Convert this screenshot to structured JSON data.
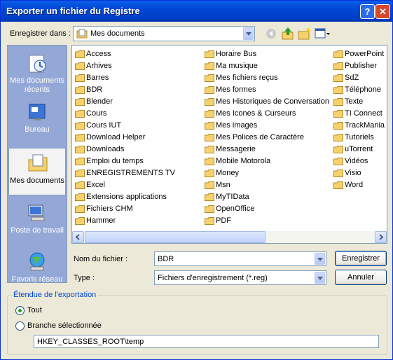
{
  "window": {
    "title": "Exporter un fichier du Registre",
    "help": "?",
    "close": "✕"
  },
  "location": {
    "label": "Enregistrer dans :",
    "value": "Mes documents"
  },
  "places": [
    {
      "label": "Mes documents récents"
    },
    {
      "label": "Bureau"
    },
    {
      "label": "Mes documents"
    },
    {
      "label": "Poste de travail"
    },
    {
      "label": "Favoris réseau"
    }
  ],
  "files": {
    "col1": [
      "Access",
      "Arhives",
      "Barres",
      "BDR",
      "Blender",
      "Cours",
      "Cours IUT",
      "Download Helper",
      "Downloads",
      "Emploi du temps",
      "ENREGISTREMENTS TV",
      "Excel",
      "Extensions applications",
      "Fichiers CHM",
      "Hammer"
    ],
    "col2": [
      "Horaire Bus",
      "Ma musique",
      "Mes fichiers reçus",
      "Mes formes",
      "Mes Historiques de Conversation",
      "Mes Icones & Curseurs",
      "Mes images",
      "Mes Polices de Caractère",
      "Messagerie",
      "Mobile Motorola",
      "Money",
      "Msn",
      "MyTIData",
      "OpenOffice",
      "PDF"
    ],
    "col3": [
      "PowerPoint",
      "Publisher",
      "SdZ",
      "Téléphone",
      "Texte",
      "TI Connect",
      "TrackMania",
      "Tutoriels",
      "uTorrent",
      "Vidéos",
      "Visio",
      "Word"
    ]
  },
  "filename": {
    "label": "Nom du fichier :",
    "value": "BDR"
  },
  "filetype": {
    "label": "Type :",
    "value": "Fichiers d'enregistrement (*.reg)"
  },
  "buttons": {
    "save": "Enregistrer",
    "cancel": "Annuler"
  },
  "export_range": {
    "label": "Étendue de l'exportation",
    "all": "Tout",
    "branch": "Branche sélectionnée",
    "branch_value": "HKEY_CLASSES_ROOT\\temp",
    "selected": "all"
  },
  "colors": {
    "title_bar": "#0054e3",
    "places_bg": "#94a8d8",
    "folder": "#f7d16b"
  }
}
